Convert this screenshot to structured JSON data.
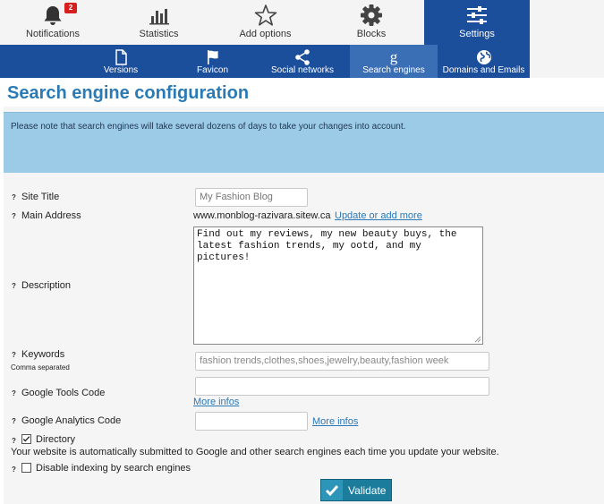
{
  "topnav": {
    "items": [
      {
        "label": "Notifications",
        "icon": "bell-icon",
        "badge": "2"
      },
      {
        "label": "Statistics",
        "icon": "bar-chart-icon"
      },
      {
        "label": "Add options",
        "icon": "star-icon"
      },
      {
        "label": "Blocks",
        "icon": "gear-icon"
      },
      {
        "label": "Settings",
        "icon": "sliders-icon",
        "active": true
      }
    ]
  },
  "subnav": {
    "items": [
      {
        "label": "Versions",
        "icon": "document-icon"
      },
      {
        "label": "Favicon",
        "icon": "flag-icon"
      },
      {
        "label": "Social networks",
        "icon": "share-icon"
      },
      {
        "label": "Search engines",
        "icon": "google-icon",
        "active": true
      },
      {
        "label": "Domains and Emails",
        "icon": "globe-icon"
      }
    ]
  },
  "page": {
    "title": "Search engine configuration",
    "notice": "Please note that search engines will take several dozens of days to take your changes into account."
  },
  "form": {
    "help_mark": "?",
    "site_title": {
      "label": "Site Title",
      "value": "My Fashion Blog"
    },
    "main_address": {
      "label": "Main Address",
      "value": "www.monblog-razivara.sitew.ca",
      "link": "Update or add more"
    },
    "description": {
      "label": "Description",
      "value": "Find out my reviews, my new beauty buys, the latest fashion trends, my ootd, and my pictures!"
    },
    "keywords": {
      "label": "Keywords",
      "hint": "Comma separated",
      "placeholder": "fashion trends,clothes,shoes,jewelry,beauty,fashion week"
    },
    "google_tools": {
      "label": "Google Tools Code",
      "value": "",
      "link": "More infos"
    },
    "google_analytics": {
      "label": "Google Analytics Code",
      "value": "",
      "link": "More infos"
    },
    "directory": {
      "label": "Directory",
      "checked": true,
      "note": "Your website is automatically submitted to Google and other search engines each time you update your website."
    },
    "disable_indexing": {
      "label": "Disable indexing by search engines",
      "checked": false
    },
    "submit_label": "Validate"
  },
  "colors": {
    "nav_blue": "#1b4f9c",
    "title_blue": "#2a7ab5",
    "notice_bg": "#9ccbe8",
    "link": "#2a78b8",
    "badge": "#d62020",
    "button": "#1b7c9c"
  }
}
